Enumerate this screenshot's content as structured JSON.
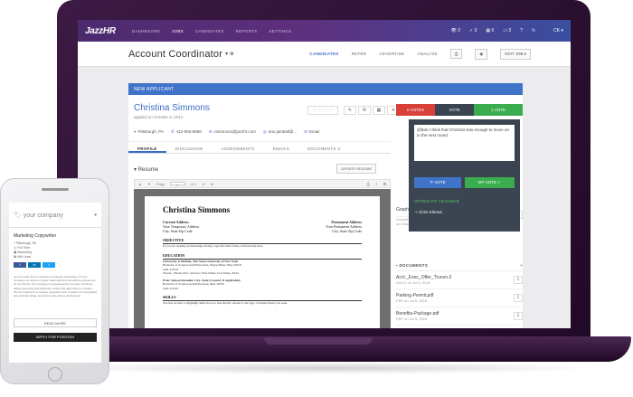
{
  "topnav": {
    "logo": "JazzHR",
    "links": [
      "DASHBOARD",
      "JOBS",
      "CANDIDATES",
      "REPORTS",
      "SETTINGS"
    ],
    "active_link": "JOBS",
    "counters": [
      "2",
      "3",
      "0",
      "3"
    ],
    "user": "CK"
  },
  "job": {
    "title": "Account Coordinator",
    "tabs": [
      "CANDIDATES",
      "REFER",
      "ADVERTISE",
      "ANALYZE"
    ],
    "edit_label": "EDIT JOB"
  },
  "panel": {
    "bar_label": "NEW APPLICANT",
    "candidate_name": "Christina Simmons",
    "applied": "applied on October 2, 2014",
    "votes_down": "0 VOTES",
    "vote_label": "VOTE",
    "votes_up": "1 VOTE",
    "contact": {
      "location": "Pittsburgh, PA",
      "phone": "412-555-8996",
      "email": "csimmons@jazzhr.com",
      "skype": "don.jamball@...",
      "email_link": "Email"
    },
    "tabs": [
      "PROFILE",
      "DISCUSSION",
      "ASSESSMENTS",
      "EMAILS",
      "DOCUMENTS 3"
    ],
    "resume_label": "Resume",
    "update_resume": "UPDATE RESUME",
    "pdf": {
      "page_label": "Page",
      "page": "1",
      "of": "of 1"
    }
  },
  "resume_doc": {
    "name": "Christina Simmons",
    "current_label": "Current Address",
    "current_line1": "Your Temporary Address",
    "current_line2": "City, State Zip Code",
    "permanent_label": "Permanent Address",
    "permanent_line1": "Your Permanent Address",
    "permanent_line2": "City, State Zip Code",
    "objective_h": "OBJECTIVE",
    "objective_p": "If you are seeking an internship during a specific time frame, indicate that here.",
    "education_h": "EDUCATION",
    "education_p1": "University at Buffalo, The State University of New York",
    "education_p2": "Bachelor of Science/Arts/Education, Major/Minor May 20XX",
    "education_p3": "GPA 3.9/4.0",
    "education_p4": "Thesis: \"Thesis title\" Advisor: First Name Last Name, Ph.D.",
    "prior_p1": "Prior School Attended, City, State (Country if applicable)",
    "prior_p2": "Bachelor of Science/Arts/Education, May 20XX",
    "prior_p3": "GPA 3.9/4.0",
    "skills_h": "SKILLS",
    "skills_p": "Use this section to highlight skills that are specifically related to the type of employment you seek."
  },
  "popover": {
    "comment": "@Bob I think that Christina has enough to move on to the next round.",
    "no_vote": "✕ VOTE",
    "yes_vote": "MY VOTE ✓",
    "voted_label": "VOTED TO ADVANCE",
    "voter": "Chris Klemut"
  },
  "sidebar": {
    "partial_title": "Graphic Designer",
    "partial_sub": "Completed by Robert Trunzo",
    "partial_date": "on October 2nd, 2014",
    "documents_head": "DOCUMENTS",
    "documents": [
      {
        "name": "Acct._Exec_Offer_Trunzo-2",
        "sub": "DOCX on Jul 5, 2016"
      },
      {
        "name": "Parking-Permit.pdf",
        "sub": "PDF on Jul 5, 2016"
      },
      {
        "name": "Benefits-Package.pdf",
        "sub": "PDF on Jul 5, 2016"
      }
    ]
  },
  "phone": {
    "logo": "your company",
    "job_title": "Marketing Copywriter",
    "meta": [
      "Pittsburgh, PA",
      "Full Time",
      "Marketing",
      "Mid Level"
    ],
    "share": [
      "f",
      "in",
      "t"
    ],
    "description": "Join the team that is redefining marketing and design. At Your Company we strive to create meaningful and innovative experiences for our clients. The company is empowered by our team members taking ownership and achieving results that align with our mission. We are looking for a creative copywriter with a passion for storytelling who will help shape our brand voice across all channels.",
    "read_more": "READ MORE",
    "apply": "APPLY FOR POSITION"
  },
  "colors": {
    "brand_blue": "#3f74c9",
    "vote_red": "#d9403a",
    "vote_green": "#3aae4f",
    "nav_purple": "#5e2f7d"
  }
}
